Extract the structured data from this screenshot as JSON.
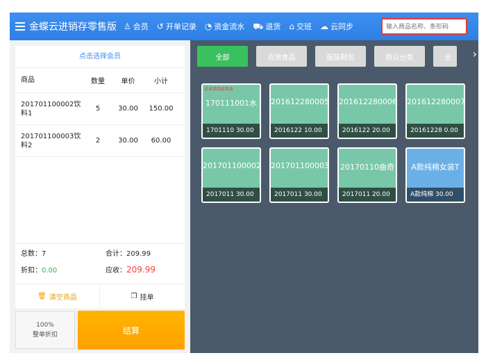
{
  "header": {
    "title": "金蝶云进销存零售版",
    "nav": [
      {
        "icon": "♙",
        "label": "会员"
      },
      {
        "icon": "↺",
        "label": "开单记录"
      },
      {
        "icon": "◔",
        "label": "资金流水"
      },
      {
        "icon": "⛟",
        "label": "退货"
      },
      {
        "icon": "⌂",
        "label": "交班"
      },
      {
        "icon": "☁",
        "label": "云同步"
      }
    ],
    "search_placeholder": "输入商品名称、条形码"
  },
  "left": {
    "member": "点击选择会员",
    "columns": {
      "name": "商品",
      "qty": "数量",
      "price": "单价",
      "sub": "小计"
    },
    "items": [
      {
        "name": "201701100002饮料1",
        "qty": "5",
        "price": "30.00",
        "sub": "150.00"
      },
      {
        "name": "201701100003饮料2",
        "qty": "2",
        "price": "30.00",
        "sub": "60.00"
      }
    ],
    "summary": {
      "count_label": "总数：7",
      "total_label": "合计：209.99",
      "discount_label": "折扣：",
      "discount_value": "0.00",
      "receivable_label": "应收：",
      "receivable_value": "209.99"
    },
    "actions": {
      "clear": "清空商品",
      "hang": "挂单"
    },
    "discount_btn": {
      "line1": "100%",
      "line2": "整单折扣"
    },
    "checkout": "结算"
  },
  "right": {
    "categories": [
      "全部",
      "百货食品",
      "服装鞋包",
      "默认分类",
      "全"
    ],
    "tiles": [
      {
        "tag": "点击添加此商品",
        "name": "170111001水",
        "foot": "1701110 30.00"
      },
      {
        "tag": "",
        "name": "201612280005",
        "foot": "2016122 10.00"
      },
      {
        "tag": "",
        "name": "201612280006",
        "foot": "2016122 20.00"
      },
      {
        "tag": "",
        "name": "201612280007",
        "foot": "20161228 0.00"
      },
      {
        "tag": "",
        "name": "201701100002",
        "foot": "2017011 30.00"
      },
      {
        "tag": "",
        "name": "201701100003",
        "foot": "2017011 30.00"
      },
      {
        "tag": "",
        "name": "20170110曲奇",
        "foot": "2017011 20.00"
      },
      {
        "tag": "",
        "name": "A款纯棉女装T",
        "foot": "A款纯棉  30.00"
      }
    ]
  }
}
